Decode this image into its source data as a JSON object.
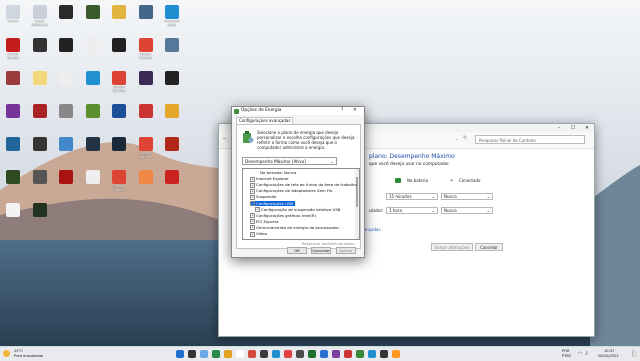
{
  "desktop": {
    "icons": [
      {
        "label": "Lixeira",
        "color": "#cfd6e0"
      },
      {
        "label": "Show Utilidades",
        "color": "#c9d0db"
      },
      {
        "label": "",
        "color": "#2a2a2a"
      },
      {
        "label": "",
        "color": "#3a5a2a"
      },
      {
        "label": "",
        "color": "#e0b640"
      },
      {
        "label": "",
        "color": "#446688"
      },
      {
        "label": "Microsoft Edge",
        "color": "#1f8fd0"
      },
      {
        "label": "Adobe Reader",
        "color": "#c41d1d"
      },
      {
        "label": "",
        "color": "#333"
      },
      {
        "label": "",
        "color": "#222"
      },
      {
        "label": "",
        "color": "#eee"
      },
      {
        "label": "",
        "color": "#222"
      },
      {
        "label": "Google Chrome",
        "color": "#dd4433"
      },
      {
        "label": "",
        "color": "#557799"
      },
      {
        "label": "",
        "color": "#9a3a3a"
      },
      {
        "label": "",
        "color": "#f1d77a"
      },
      {
        "label": "",
        "color": "#eee"
      },
      {
        "label": "",
        "color": "#2090d0"
      },
      {
        "label": "Google Chrome",
        "color": "#dd4433"
      },
      {
        "label": "",
        "color": "#3a2a55"
      },
      {
        "label": "",
        "color": "#222"
      },
      {
        "label": "",
        "color": "#773399"
      },
      {
        "label": "",
        "color": "#aa2222"
      },
      {
        "label": "",
        "color": "#888"
      },
      {
        "label": "",
        "color": "#5b8f2e"
      },
      {
        "label": "",
        "color": "#1b4f9a"
      },
      {
        "label": "",
        "color": "#cc3333"
      },
      {
        "label": "",
        "color": "#e5a72a"
      },
      {
        "label": "",
        "color": "#226699"
      },
      {
        "label": "",
        "color": "#333"
      },
      {
        "label": "",
        "color": "#4488cc"
      },
      {
        "label": "",
        "color": "#223344"
      },
      {
        "label": "",
        "color": "#1b2838"
      },
      {
        "label": "Google Chrome",
        "color": "#dd4433"
      },
      {
        "label": "",
        "color": "#b0281a"
      },
      {
        "label": "",
        "color": "#2e4a1e"
      },
      {
        "label": "",
        "color": "#555"
      },
      {
        "label": "",
        "color": "#aa1111"
      },
      {
        "label": "",
        "color": "#eeeeee"
      },
      {
        "label": "Google Chrome",
        "color": "#dd4433"
      },
      {
        "label": "",
        "color": "#ee8844"
      },
      {
        "label": "",
        "color": "#cc2222"
      },
      {
        "label": "",
        "color": "#f2f2f2"
      },
      {
        "label": "",
        "color": "#223322"
      }
    ]
  },
  "control_panel": {
    "search_placeholder": "Pesquisar Painel de Controle",
    "title": "plano: Desempenho Máximo",
    "subtitle": "que você deseja usar no computador.",
    "col_battery": "Na bateria",
    "col_plugged": "Conectado",
    "row_display_battery": "15 minutos",
    "row_display_plugged": "Nunca",
    "row_sleep_label": "utador:",
    "row_sleep_battery": "1 hora",
    "row_sleep_plugged": "Nunca",
    "advanced_link": "avançadas",
    "save_button": "Salvar alterações",
    "cancel_button": "Cancelar"
  },
  "dialog": {
    "title": "Opções de Energia",
    "help": "?",
    "close": "✕",
    "tab": "Configurações avançadas",
    "description": "Selecione o plano de energia que deseja personalizar e escolha configurações que deseja refletir a forma como você deseja que o computador administre a energia.",
    "plan": "Desempenho Máximo [Ativo]",
    "tree": [
      {
        "text": "Na tomada: Nunca",
        "indent": 3,
        "pm": "",
        "sel": false
      },
      {
        "text": "Internet Explorer",
        "indent": 1,
        "pm": "+",
        "sel": false
      },
      {
        "text": "Configurações de tela de fundo da área de trabalho",
        "indent": 1,
        "pm": "+",
        "sel": false
      },
      {
        "text": "Configurações de Adaptadores Sem Fio",
        "indent": 1,
        "pm": "+",
        "sel": false
      },
      {
        "text": "Suspender",
        "indent": 1,
        "pm": "+",
        "sel": false
      },
      {
        "text": "Configurações USB",
        "indent": 1,
        "pm": "−",
        "sel": true
      },
      {
        "text": "Configuração de suspensão seletiva USB",
        "indent": 2,
        "pm": "+",
        "sel": false
      },
      {
        "text": "Configurações gráficas Intel(R)",
        "indent": 1,
        "pm": "+",
        "sel": false
      },
      {
        "text": "PCI Express",
        "indent": 1,
        "pm": "+",
        "sel": false
      },
      {
        "text": "Gerenciamento de energia do processador",
        "indent": 1,
        "pm": "+",
        "sel": false
      },
      {
        "text": "Vídeo",
        "indent": 1,
        "pm": "+",
        "sel": false
      }
    ],
    "restore": "Restaurar padrões do plano",
    "ok": "OK",
    "cancel": "Cancelar",
    "apply": "Aplicar"
  },
  "taskbar": {
    "weather_temp": "25°C",
    "weather_text": "Pred ensolarado",
    "lang1": "POR",
    "lang2": "PTB2",
    "time": "10:37",
    "date": "26/10/2022",
    "icons": [
      "#1f6fd0",
      "#333",
      "#6aa8e8",
      "#2a8a4a",
      "#e0a020",
      "#ffffff",
      "#d24a3a",
      "#3c3c3c",
      "#1f8fd0",
      "#e04040",
      "#4a4a4a",
      "#1d6e2b",
      "#2a6fd0",
      "#7b3fa0",
      "#cc3333",
      "#3a8a3a",
      "#1f8fd0",
      "#333",
      "#ff9922"
    ]
  }
}
